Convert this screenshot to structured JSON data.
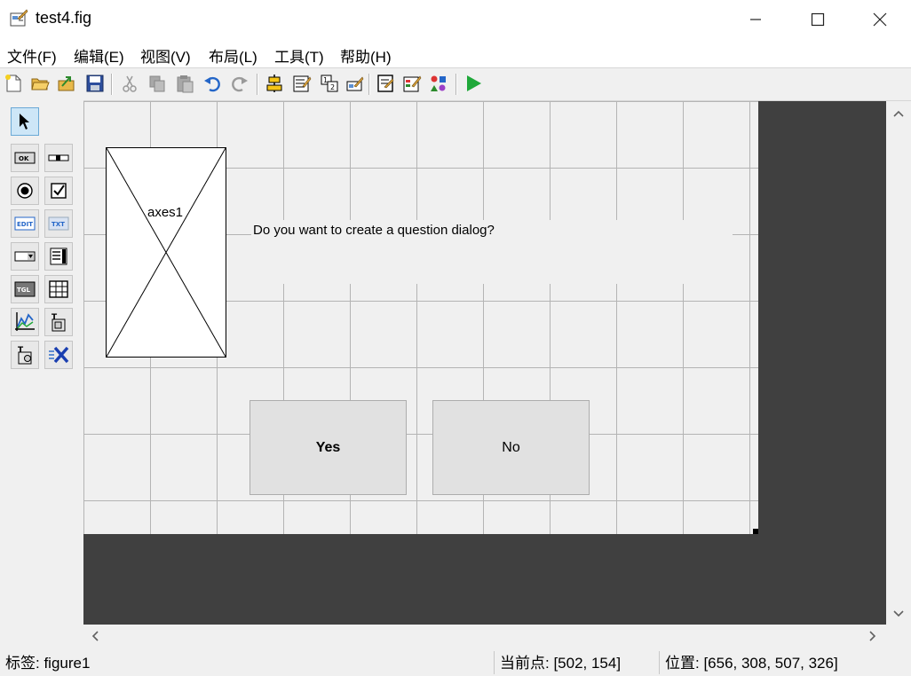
{
  "window": {
    "title": "test4.fig"
  },
  "menu": [
    "文件(F)",
    "编辑(E)",
    "视图(V)",
    "布局(L)",
    "工具(T)",
    "帮助(H)"
  ],
  "figure": {
    "axes_label": "axes1",
    "question_text": "Do you want to create a question dialog?",
    "yes_label": "Yes",
    "no_label": "No"
  },
  "status": {
    "tag": "标签: figure1",
    "current_point": "当前点:  [502, 154]",
    "position": "位置: [656, 308, 507, 326]"
  }
}
